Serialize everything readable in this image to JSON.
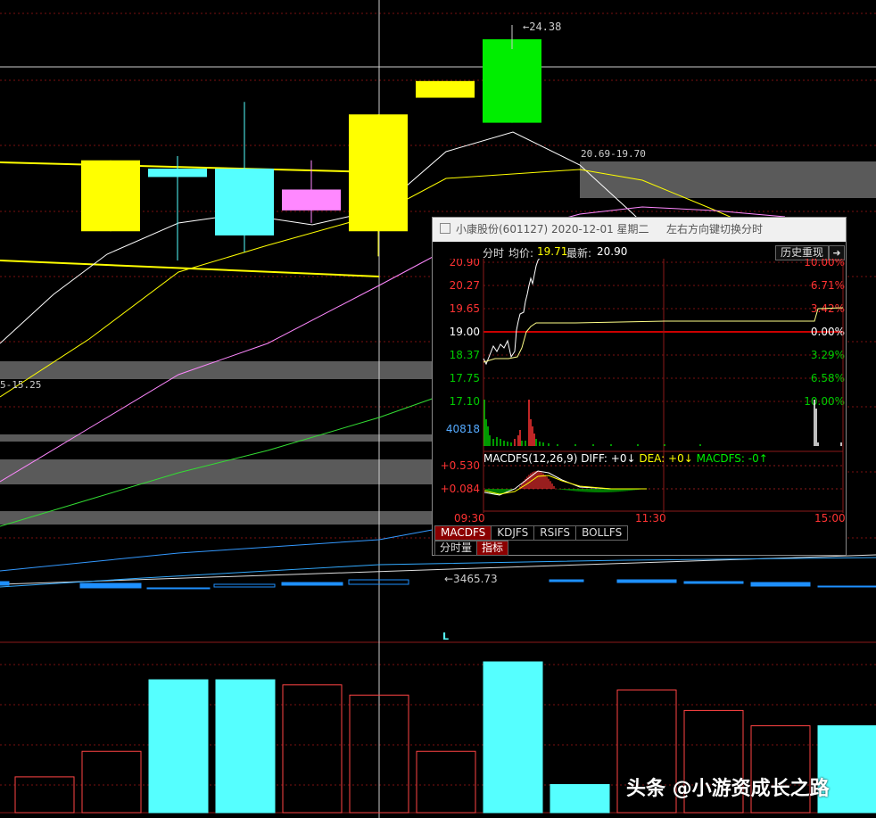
{
  "main_chart": {
    "top_price_label": "24.38",
    "band_upper_label": "20.69-19.70",
    "band_lower_label": "5-15.25",
    "index_label": "3465.73",
    "marker_label": "L",
    "candles": [
      {
        "o": 20.4,
        "c": 22.1,
        "h": 22.1,
        "l": 20.4,
        "color": "#ffff00",
        "filled": true
      },
      {
        "o": 21.9,
        "c": 21.7,
        "h": 22.2,
        "l": 19.7,
        "color": "#55ffff",
        "filled": true
      },
      {
        "o": 20.3,
        "c": 21.9,
        "h": 23.5,
        "l": 19.9,
        "color": "#55ffff",
        "filled": true
      },
      {
        "o": 20.9,
        "c": 21.4,
        "h": 22.1,
        "l": 20.6,
        "color": "#ff88ff",
        "filled": true
      },
      {
        "o": 20.4,
        "c": 23.2,
        "h": 23.2,
        "l": 19.8,
        "color": "#ffff00",
        "filled": true
      },
      {
        "o": 24.0,
        "c": 23.6,
        "h": 24.0,
        "l": 23.6,
        "color": "#ffff00",
        "filled": true
      },
      {
        "o": 23.0,
        "c": 25.0,
        "h": 25.3,
        "l": 23.0,
        "color": "#00ee00",
        "filled": true
      }
    ],
    "volumes": [
      {
        "v": 14,
        "color": "#ff4444",
        "filled": false
      },
      {
        "v": 24,
        "color": "#ff4444",
        "filled": false
      },
      {
        "v": 52,
        "color": "#55ffff",
        "filled": true
      },
      {
        "v": 52,
        "color": "#55ffff",
        "filled": true
      },
      {
        "v": 50,
        "color": "#ff4444",
        "filled": false
      },
      {
        "v": 46,
        "color": "#ff4444",
        "filled": false
      },
      {
        "v": 24,
        "color": "#ff4444",
        "filled": false
      },
      {
        "v": 59,
        "color": "#55ffff",
        "filled": true
      },
      {
        "v": 11,
        "color": "#55ffff",
        "filled": true
      },
      {
        "v": 48,
        "color": "#ff4444",
        "filled": false
      },
      {
        "v": 40,
        "color": "#ff4444",
        "filled": false
      },
      {
        "v": 34,
        "color": "#ff4444",
        "filled": false
      },
      {
        "v": 34,
        "color": "#55ffff",
        "filled": true
      }
    ]
  },
  "popup": {
    "title": "小康股份(601127)  2020-12-01  星期二",
    "hint": "左右方向键切换分时",
    "info_label": "分时",
    "avg_label": "均价:",
    "avg_value": "19.71",
    "latest_label": "最新:",
    "latest_value": "20.90",
    "history_button": "历史重现",
    "exit_glyph": "➜",
    "price_axis": [
      "20.90",
      "20.27",
      "19.65",
      "19.00",
      "18.37",
      "17.75",
      "17.10"
    ],
    "pct_axis": [
      "10.00%",
      "6.71%",
      "3.42%",
      "0.00%",
      "3.29%",
      "6.58%",
      "10.00%"
    ],
    "volume_label": "40818",
    "macd_header_name": "MACDFS(12,26,9)",
    "macd_diff": "DIFF: +0↓",
    "macd_dea": "DEA: +0↓",
    "macd_val": "MACDFS: -0↑",
    "macd_axis": [
      "+0.530",
      "+0.084"
    ],
    "time_axis": [
      "09:30",
      "11:30",
      "15:00"
    ],
    "tabs": [
      {
        "label": "MACDFS",
        "active": true
      },
      {
        "label": "KDJFS",
        "active": false
      },
      {
        "label": "RSIFS",
        "active": false
      },
      {
        "label": "BOLLFS",
        "active": false
      }
    ],
    "subtabs": [
      {
        "label": "分时量",
        "active": false
      },
      {
        "label": "指标",
        "active": true
      }
    ]
  },
  "watermark": {
    "text": "头条 @小游资成长之路"
  },
  "colors": {
    "up": "#ff3333",
    "down": "#00cc00",
    "flat": "#ffffff",
    "yellow": "#ffff00",
    "cyan": "#55ffff",
    "magenta": "#ff88ff",
    "green": "#00ee00",
    "blue_line": "#1e90ff"
  }
}
